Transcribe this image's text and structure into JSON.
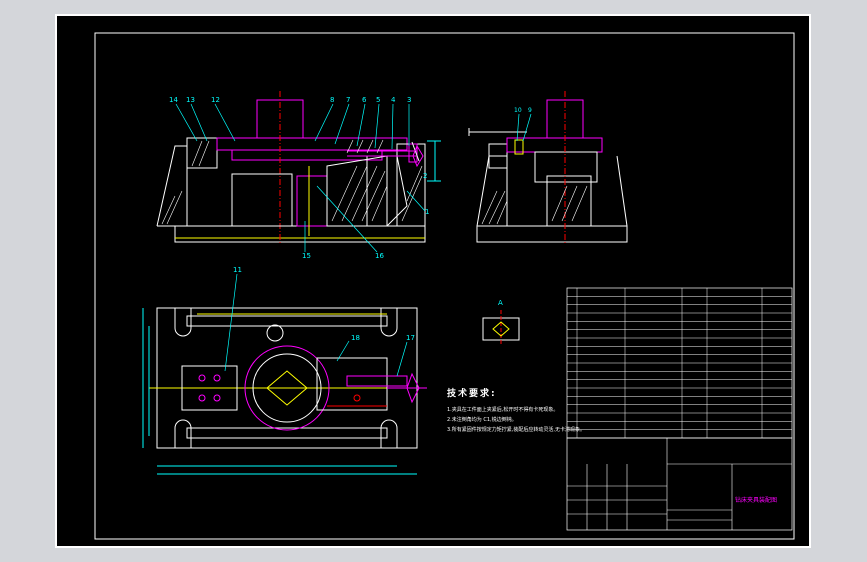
{
  "drawing": {
    "colors": {
      "background": "#000000",
      "outline": "#ffffff",
      "part": "#ff00ff",
      "dimension": "#00ffff",
      "hatch": "#ffffff",
      "centerline": "#ff0000",
      "highlight": "#ffff00",
      "blue": "#2020ff"
    },
    "front_view_callouts": [
      "14",
      "13",
      "12",
      "8",
      "7",
      "6",
      "5",
      "4",
      "3",
      "2",
      "1",
      "15",
      "16"
    ],
    "side_view_callouts": [
      "10",
      "9"
    ],
    "plan_view_callouts": [
      "11",
      "18",
      "17"
    ],
    "section_label": "A",
    "tech_notes": {
      "title": "技术要求:",
      "lines": [
        "1.夹具在工件面上夹紧后,松开时不得有卡死现象。",
        "2.未注倒角均为 C1,锐边倒钝。",
        "3.所有紧固件按规定力矩拧紧,装配后应转动灵活,无卡滞现象。"
      ]
    },
    "title_block_name": "钻床夹具装配图"
  }
}
